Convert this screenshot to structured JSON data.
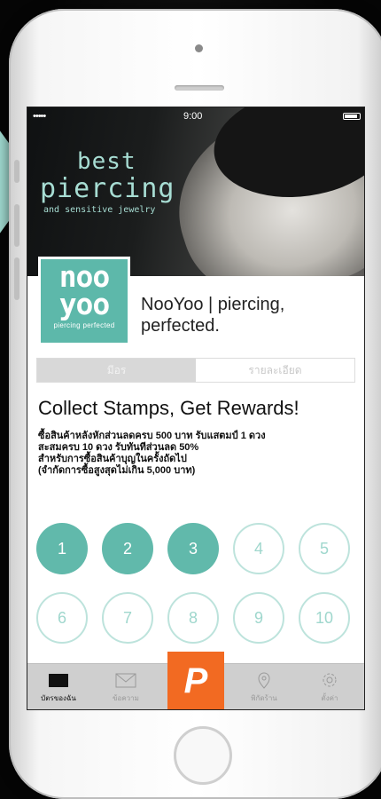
{
  "status_bar": {
    "signal": "•••••",
    "time": "9:00"
  },
  "hero": {
    "title_line1": "best",
    "title_line2": "piercing",
    "subtitle": "and sensitive jewelry"
  },
  "brand": {
    "logo_line1": "noo",
    "logo_line2": "yoo",
    "logo_tagline": "piercing perfected",
    "shop_name": "NooYoo | piercing, perfected."
  },
  "segments": [
    {
      "label": "มีอร"
    },
    {
      "label": "รายละเอียด"
    }
  ],
  "promo": {
    "title": "Collect Stamps, Get Rewards!",
    "lines": [
      "ซื้อสินค้าหลังหักส่วนลดครบ 500 บาท รับแสตมป์ 1 ดวง",
      "สะสมครบ 10 ดวง รับทันทีส่วนลด 50%",
      "สำหรับการซื้อสินค้าบุญในครั้งถัดไป",
      "(จำกัดการซื้อสูงสุดไม่เกิน 5,000 บาท)"
    ]
  },
  "stamps": [
    {
      "label": "1",
      "filled": true
    },
    {
      "label": "2",
      "filled": true
    },
    {
      "label": "3",
      "filled": true
    },
    {
      "label": "4",
      "filled": false
    },
    {
      "label": "5",
      "filled": false
    },
    {
      "label": "6",
      "filled": false
    },
    {
      "label": "7",
      "filled": false
    },
    {
      "label": "8",
      "filled": false
    },
    {
      "label": "9",
      "filled": false
    },
    {
      "label": "10",
      "filled": false
    }
  ],
  "tabbar": {
    "tabs": [
      {
        "label": "บัตรของฉัน",
        "icon": "card-icon"
      },
      {
        "label": "ข้อความ",
        "icon": "mail-icon"
      },
      {
        "label": "P",
        "icon": "p-logo-icon"
      },
      {
        "label": "พิกัดร้าน",
        "icon": "location-pin-icon"
      },
      {
        "label": "ตั้งค่า",
        "icon": "gear-icon"
      }
    ]
  },
  "colors": {
    "accent": "#5db8aa",
    "accent_light": "#bde3dc",
    "center_button": "#f26a22",
    "side_arrow": "#9fd9cf"
  }
}
